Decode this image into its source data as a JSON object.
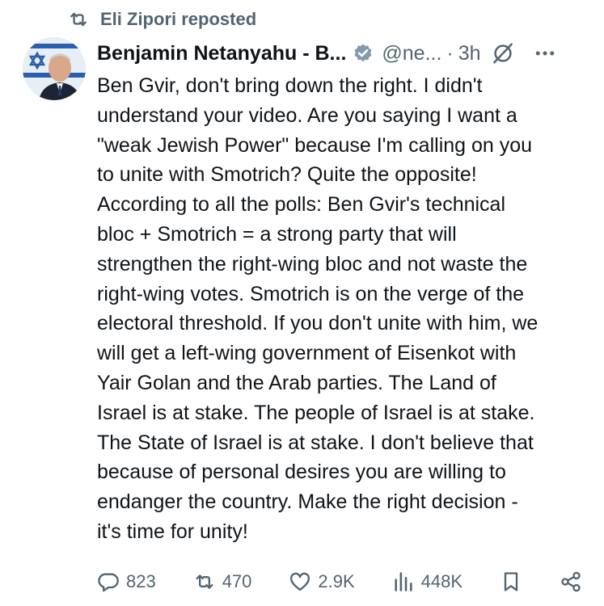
{
  "repost": {
    "label": "Eli Zipori reposted",
    "icon": "repost-icon"
  },
  "post": {
    "author_name": "Benjamin Netanyahu - B...",
    "handle": "@ne...",
    "separator": "·",
    "time": "3h",
    "text": "Ben Gvir, don't bring down the right. I didn't\nunderstand your video. Are you saying I want a\n\"weak Jewish Power\" because I'm calling on you\nto unite with Smotrich? Quite the opposite!\nAccording to all the polls: Ben Gvir's technical\nbloc + Smotrich = a strong party that will\nstrengthen the right-wing bloc and not waste the\nright-wing votes. Smotrich is on the verge of the\nelectoral threshold. If you don't unite with him, we\nwill get a left-wing government of Eisenkot with\nYair Golan and the Arab parties. The Land of\nIsrael is at stake. The people of Israel is at stake.\nThe State of Israel is at stake. I don't believe that\nbecause of personal desires you are willing to\nendanger the country. Make the right decision -\nit's time for unity!"
  },
  "actions": {
    "replies": "823",
    "reposts": "470",
    "likes": "2.9K",
    "views": "448K"
  },
  "colors": {
    "text": "#0f1419",
    "secondary": "#536471",
    "verified_badge": "#829aab",
    "flag_blue": "#2a5fb0"
  },
  "icons": [
    "repost-icon",
    "verified-badge-icon",
    "grok-icon",
    "more-icon",
    "reply-icon",
    "like-icon",
    "views-icon",
    "bookmark-icon",
    "share-icon"
  ]
}
